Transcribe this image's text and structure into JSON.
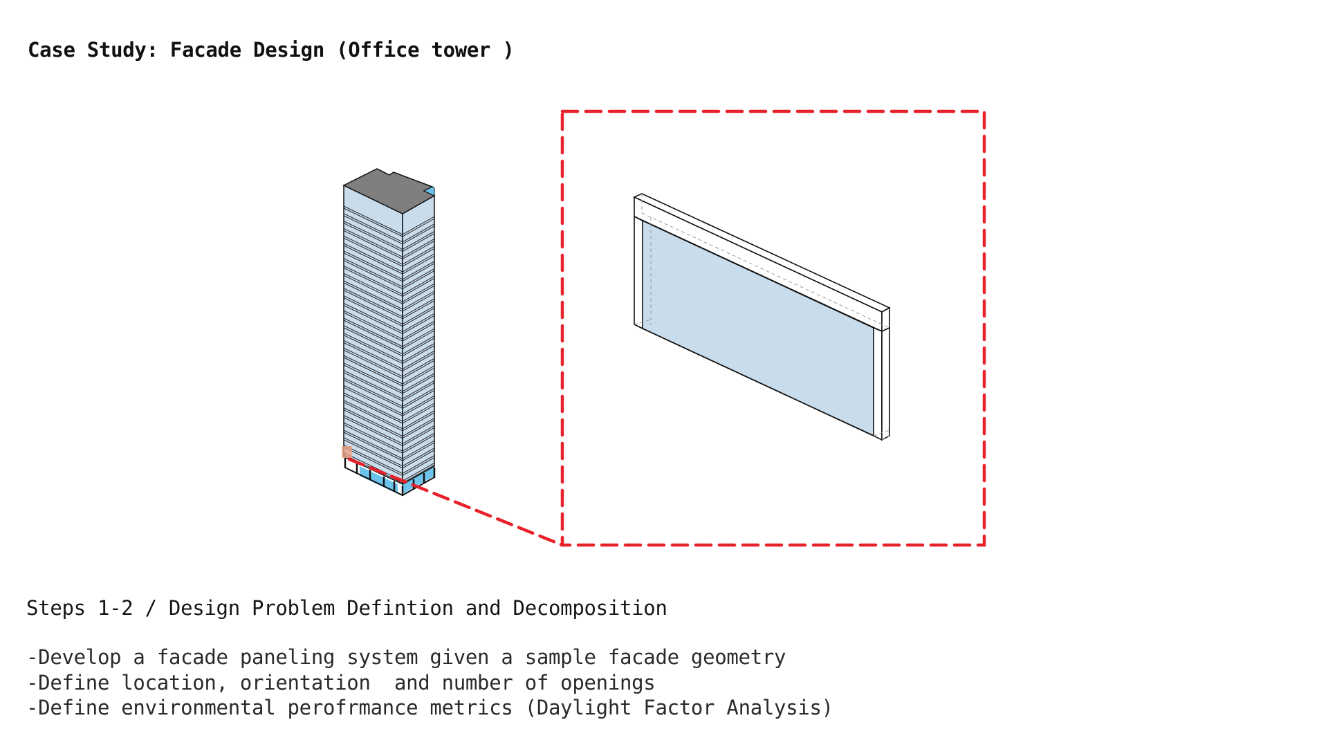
{
  "slide": {
    "title": "Case Study: Facade Design (Office tower )",
    "section_heading": "Steps 1-2 / Design Problem Defintion and Decomposition",
    "bullets": [
      "-Develop a facade paneling system given a sample facade geometry",
      "-Define location, orientation  and number of openings",
      "-Define environmental perofrmance metrics (Daylight Factor Analysis)"
    ]
  },
  "diagram": {
    "tower": {
      "label": "office-tower-isometric"
    },
    "callout": {
      "label": "facade-panel-detail",
      "highlight": "selected-facade-panel"
    },
    "colors": {
      "accent_red": "#e8202a",
      "glass": "#c9dcec",
      "roof": "#7f7f7f",
      "outline": "#111111",
      "highlight": "#f0a080",
      "lobby_glass": "#6cc4ec"
    }
  }
}
